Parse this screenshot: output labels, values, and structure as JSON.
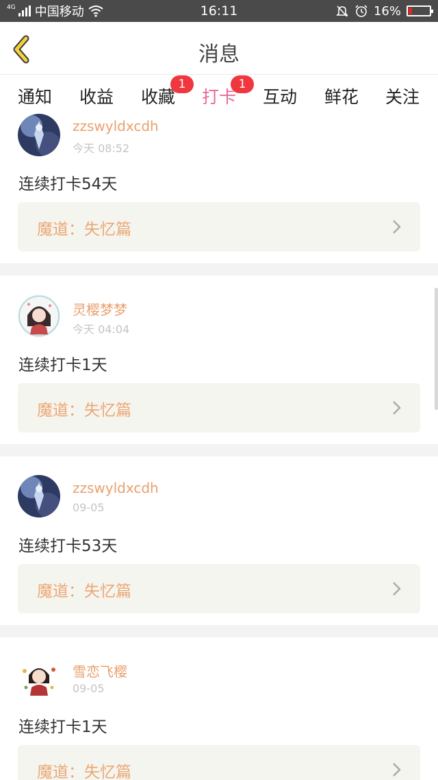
{
  "status_bar": {
    "network": "4G",
    "carrier": "中国移动",
    "time": "16:11",
    "battery": "16%",
    "battery_level": 0.16,
    "icons": [
      "signal-icon",
      "wifi-icon",
      "mute-bell-icon",
      "alarm-icon",
      "battery-icon"
    ]
  },
  "header": {
    "title": "消息",
    "back_icon": "chevron-left-icon",
    "accent_color": "#f5d23a"
  },
  "tabs": [
    {
      "label": "通知",
      "badge": ""
    },
    {
      "label": "收益",
      "badge": ""
    },
    {
      "label": "收藏",
      "badge": "1"
    },
    {
      "label": "打卡",
      "badge": "1",
      "active": true
    },
    {
      "label": "互动",
      "badge": ""
    },
    {
      "label": "鲜花",
      "badge": ""
    },
    {
      "label": "关注",
      "badge": ""
    }
  ],
  "colors": {
    "active_tab": "#e8689a",
    "username": "#e9a06e",
    "badge": "#f0363f"
  },
  "messages": [
    {
      "username": "zzswyldxcdh",
      "time": "今天 08:52",
      "text": "连续打卡54天",
      "book": "魔道：失忆篇",
      "avatar": "avatar-blue"
    },
    {
      "username": "灵樱梦梦",
      "time": "今天 04:04",
      "text": "连续打卡1天",
      "book": "魔道：失忆篇",
      "avatar": "avatar-girl"
    },
    {
      "username": "zzswyldxcdh",
      "time": "09-05",
      "text": "连续打卡53天",
      "book": "魔道：失忆篇",
      "avatar": "avatar-blue"
    },
    {
      "username": "雪恋飞樱",
      "time": "09-05",
      "text": "连续打卡1天",
      "book": "魔道：失忆篇",
      "avatar": "avatar-chibi"
    }
  ]
}
